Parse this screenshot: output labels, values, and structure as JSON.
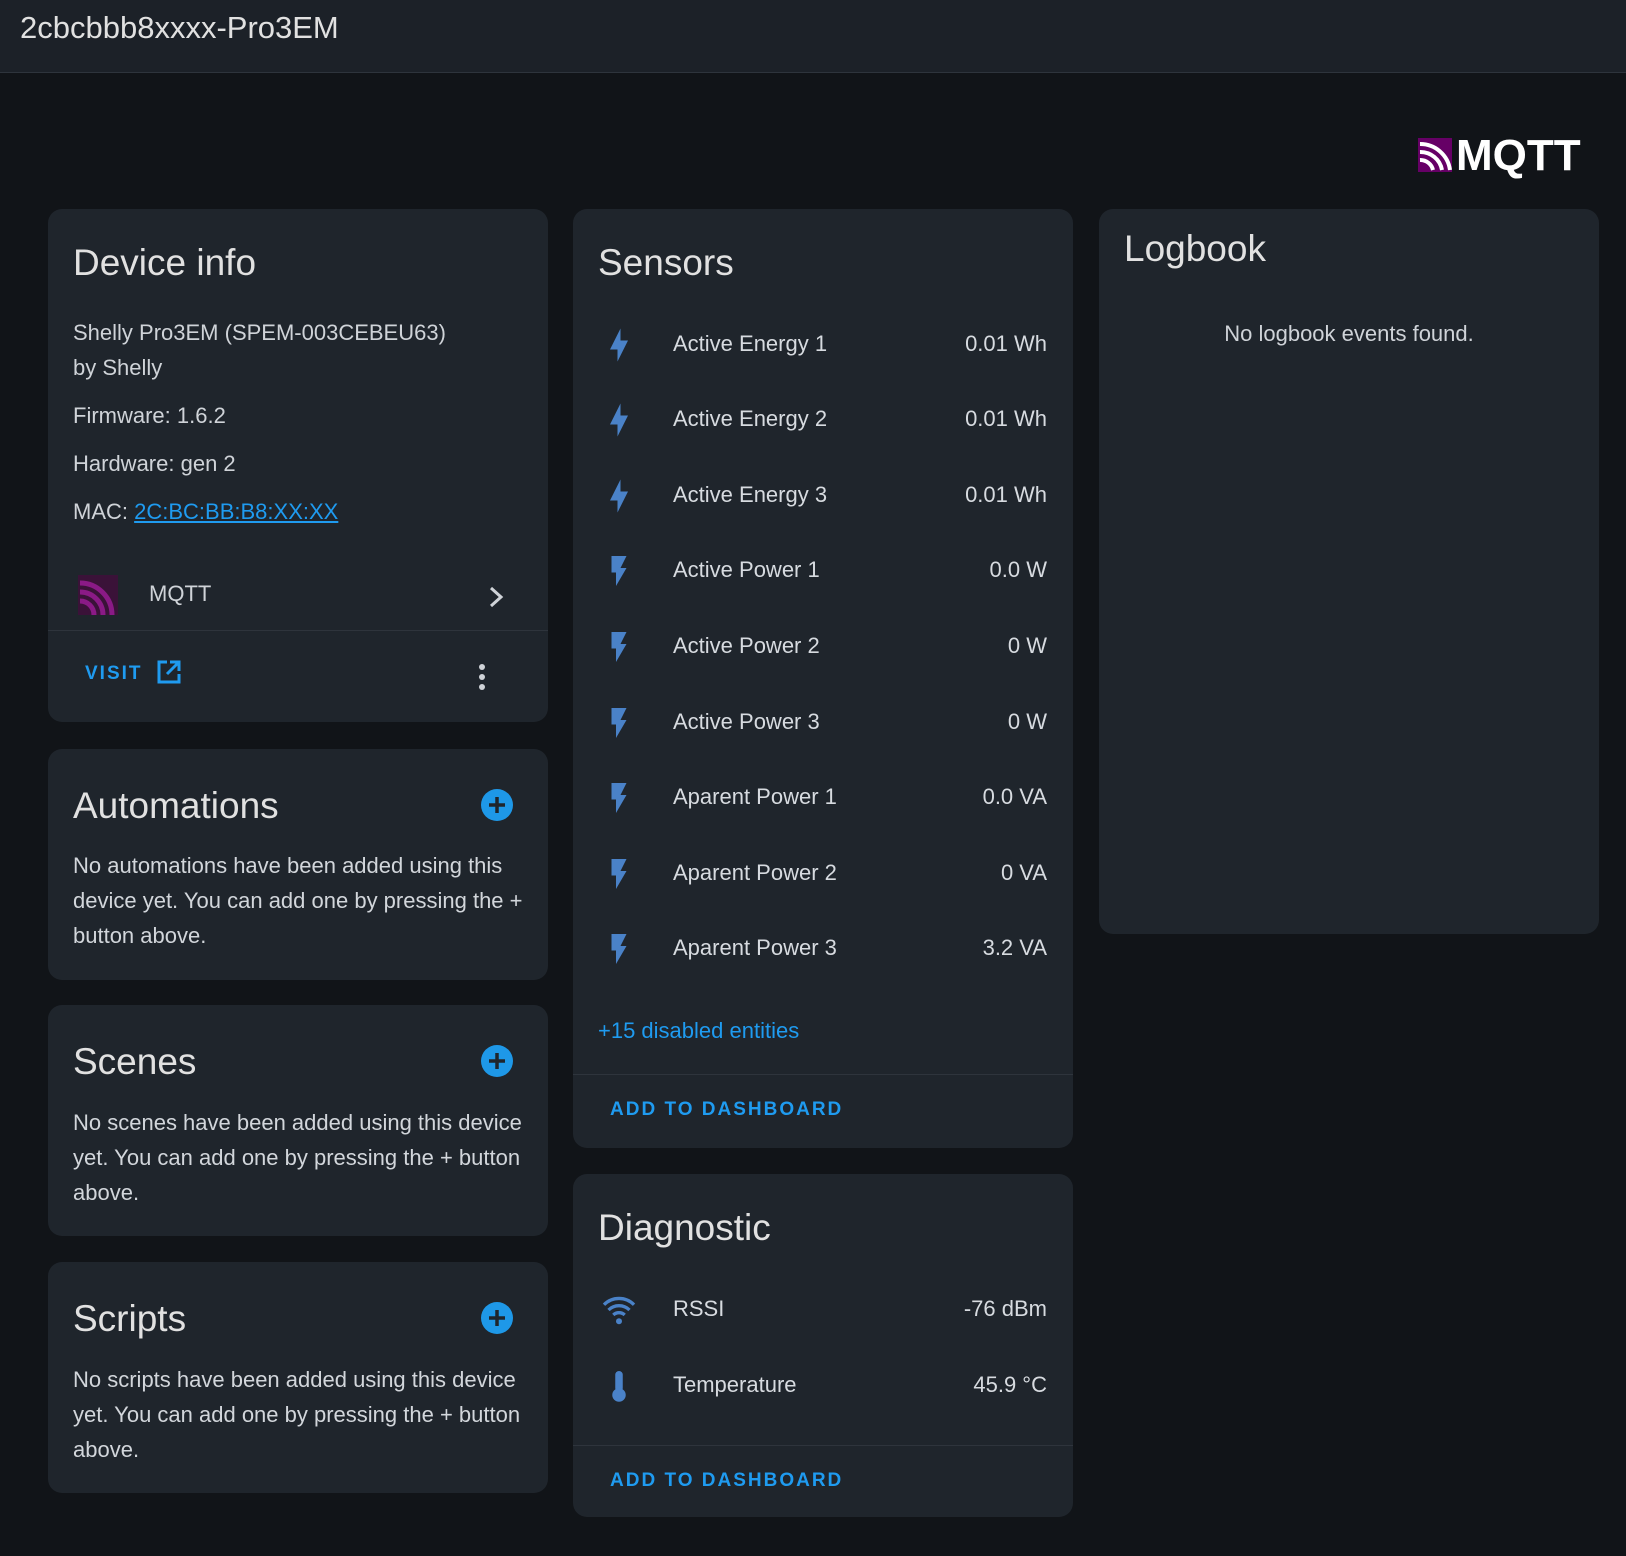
{
  "header": {
    "title": "2cbcbbb8xxxx-Pro3EM"
  },
  "brand": {
    "logo_text": "MQTT",
    "accent": "#660066"
  },
  "device_info": {
    "title": "Device info",
    "model": "Shelly Pro3EM (SPEM-003CEBEU63)",
    "manufacturer": "by Shelly",
    "firmware": "Firmware: 1.6.2",
    "hardware": "Hardware: gen 2",
    "mac_label": "MAC: ",
    "mac_value": "2C:BC:BB:B8:XX:XX",
    "integration": "MQTT",
    "visit_label": "VISIT"
  },
  "automations": {
    "title": "Automations",
    "empty_text_lines": [
      "No automations have been added using this",
      "device yet. You can add one by pressing the +",
      "button above."
    ]
  },
  "scenes": {
    "title": "Scenes",
    "empty_text_lines": [
      "No scenes have been added using this device",
      "yet. You can add one by pressing the + button",
      "above."
    ]
  },
  "scripts": {
    "title": "Scripts",
    "empty_text_lines": [
      "No scripts have been added using this device",
      "yet. You can add one by pressing the + button",
      "above."
    ]
  },
  "sensors": {
    "title": "Sensors",
    "items": [
      {
        "name": "Active Energy 1",
        "value": "0.01 Wh",
        "icon": "lightning-bolt-icon"
      },
      {
        "name": "Active Energy 2",
        "value": "0.01 Wh",
        "icon": "lightning-bolt-icon"
      },
      {
        "name": "Active Energy 3",
        "value": "0.01 Wh",
        "icon": "lightning-bolt-icon"
      },
      {
        "name": "Active Power 1",
        "value": "0.0 W",
        "icon": "flash-icon"
      },
      {
        "name": "Active Power 2",
        "value": "0 W",
        "icon": "flash-icon"
      },
      {
        "name": "Active Power 3",
        "value": "0 W",
        "icon": "flash-icon"
      },
      {
        "name": "Aparent Power 1",
        "value": "0.0 VA",
        "icon": "flash-icon"
      },
      {
        "name": "Aparent Power 2",
        "value": "0 VA",
        "icon": "flash-icon"
      },
      {
        "name": "Aparent Power 3",
        "value": "3.2 VA",
        "icon": "flash-icon"
      }
    ],
    "disabled_link": "+15 disabled entities",
    "add_button": "ADD TO DASHBOARD"
  },
  "diagnostic": {
    "title": "Diagnostic",
    "items": [
      {
        "name": "RSSI",
        "value": "-76 dBm",
        "icon": "wifi-icon"
      },
      {
        "name": "Temperature",
        "value": "45.9 °C",
        "icon": "thermometer-icon"
      }
    ],
    "add_button": "ADD TO DASHBOARD"
  },
  "logbook": {
    "title": "Logbook",
    "empty_text": "No logbook events found."
  }
}
